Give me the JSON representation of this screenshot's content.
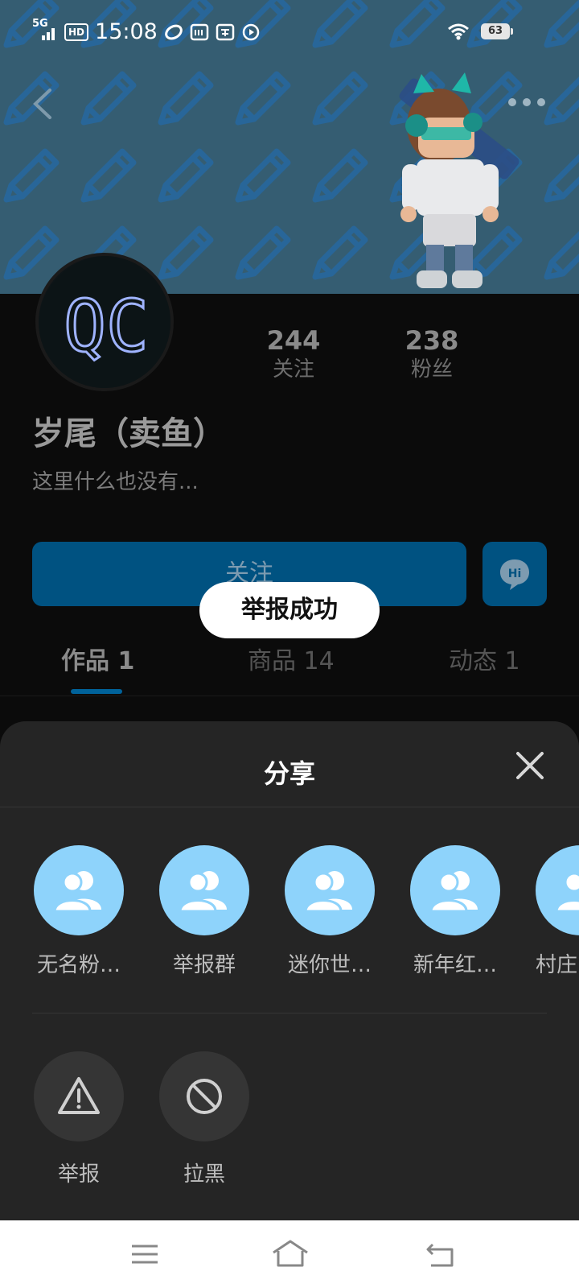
{
  "status_bar": {
    "network": "5G",
    "hd_badge": "HD",
    "time": "15:08",
    "app_badges": [
      "weibo-icon",
      "iqiyi-icon",
      "taobao-icon",
      "video-icon"
    ],
    "battery": "63"
  },
  "profile": {
    "avatar_text": "QC",
    "following_count": "244",
    "following_label": "关注",
    "followers_count": "238",
    "followers_label": "粉丝",
    "username": "岁尾（卖鱼）",
    "bio": "这里什么也没有..."
  },
  "actions": {
    "follow_label": "关注",
    "chat_icon_text": "Hi"
  },
  "tabs": [
    {
      "label": "作品 1",
      "active": true
    },
    {
      "label": "商品 14",
      "active": false
    },
    {
      "label": "动态 1",
      "active": false
    }
  ],
  "toast": "举报成功",
  "share_sheet": {
    "title": "分享",
    "targets": [
      {
        "label": "无名粉…"
      },
      {
        "label": "举报群"
      },
      {
        "label": "迷你世…"
      },
      {
        "label": "新年红…"
      },
      {
        "label": "村庄"
      }
    ],
    "actions": [
      {
        "label": "举报",
        "icon": "warning-icon"
      },
      {
        "label": "拉黑",
        "icon": "block-icon"
      }
    ]
  },
  "colors": {
    "accent": "#005281",
    "share_circle": "#8ed3fb",
    "sheet_bg": "#252525"
  }
}
